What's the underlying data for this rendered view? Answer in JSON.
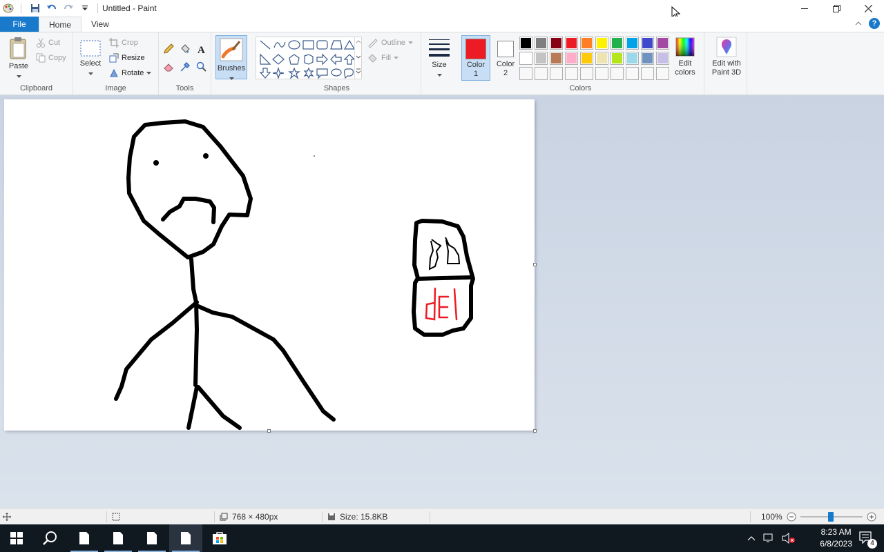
{
  "window": {
    "title": "Untitled - Paint"
  },
  "tabs": {
    "file": "File",
    "home": "Home",
    "view": "View"
  },
  "ribbon": {
    "clipboard": {
      "paste": "Paste",
      "cut": "Cut",
      "copy": "Copy",
      "label": "Clipboard"
    },
    "image": {
      "select": "Select",
      "crop": "Crop",
      "resize": "Resize",
      "rotate": "Rotate",
      "label": "Image"
    },
    "tools": {
      "label": "Tools"
    },
    "brushes": {
      "label": "Brushes"
    },
    "shapes": {
      "outline": "Outline",
      "fill": "Fill",
      "label": "Shapes"
    },
    "size": {
      "label": "Size"
    },
    "colors": {
      "color1": [
        "Color",
        "1"
      ],
      "color2": [
        "Color",
        "2"
      ],
      "edit": [
        "Edit",
        "colors"
      ],
      "label": "Colors",
      "color1_value": "#ed1c24",
      "color2_value": "#ffffff",
      "palette_row1": [
        "#000000",
        "#7f7f7f",
        "#880015",
        "#ed1c24",
        "#ff7f27",
        "#fff200",
        "#22b14c",
        "#00a2e8",
        "#3f48cc",
        "#a349a4"
      ],
      "palette_row2": [
        "#ffffff",
        "#c3c3c3",
        "#b97a57",
        "#ffaec9",
        "#ffc90e",
        "#efe4b0",
        "#b5e61d",
        "#99d9ea",
        "#7092be",
        "#c8bfe7"
      ]
    },
    "paint3d": [
      "Edit with",
      "Paint 3D"
    ]
  },
  "canvas": {
    "drawing_text": "del"
  },
  "statusbar": {
    "dimensions": "768 × 480px",
    "size": "Size: 15.8KB",
    "zoom": "100%"
  },
  "taskbar": {
    "time": "8:23 AM",
    "date": "6/8/2023",
    "notifications": "4"
  }
}
